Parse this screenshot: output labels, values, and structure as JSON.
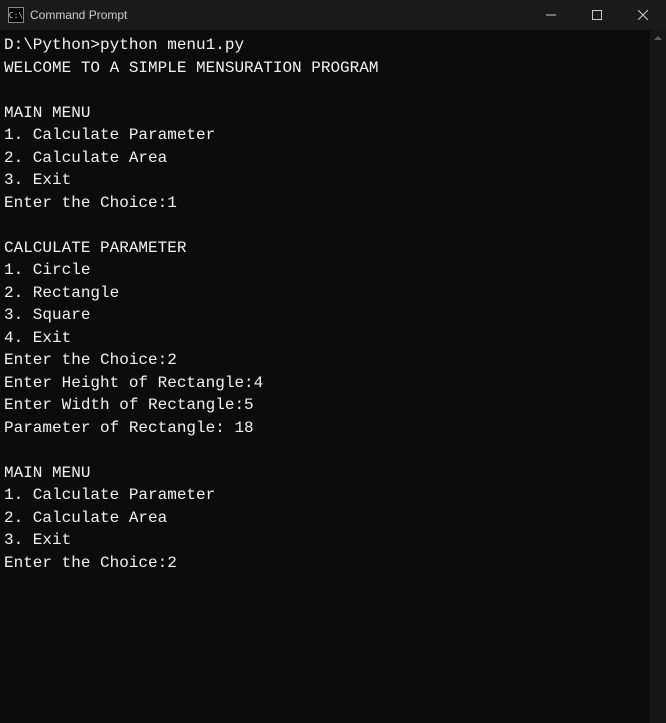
{
  "window": {
    "title": "Command Prompt",
    "icon_text": "C:\\"
  },
  "terminal": {
    "prompt": "D:\\Python>",
    "command": "python menu1.py",
    "lines": [
      "WELCOME TO A SIMPLE MENSURATION PROGRAM",
      "",
      "MAIN MENU",
      "1. Calculate Parameter",
      "2. Calculate Area",
      "3. Exit",
      "Enter the Choice:1",
      "",
      "CALCULATE PARAMETER",
      "1. Circle",
      "2. Rectangle",
      "3. Square",
      "4. Exit",
      "Enter the Choice:2",
      "Enter Height of Rectangle:4",
      "Enter Width of Rectangle:5",
      "Parameter of Rectangle: 18",
      "",
      "MAIN MENU",
      "1. Calculate Parameter",
      "2. Calculate Area",
      "3. Exit",
      "Enter the Choice:2"
    ]
  }
}
